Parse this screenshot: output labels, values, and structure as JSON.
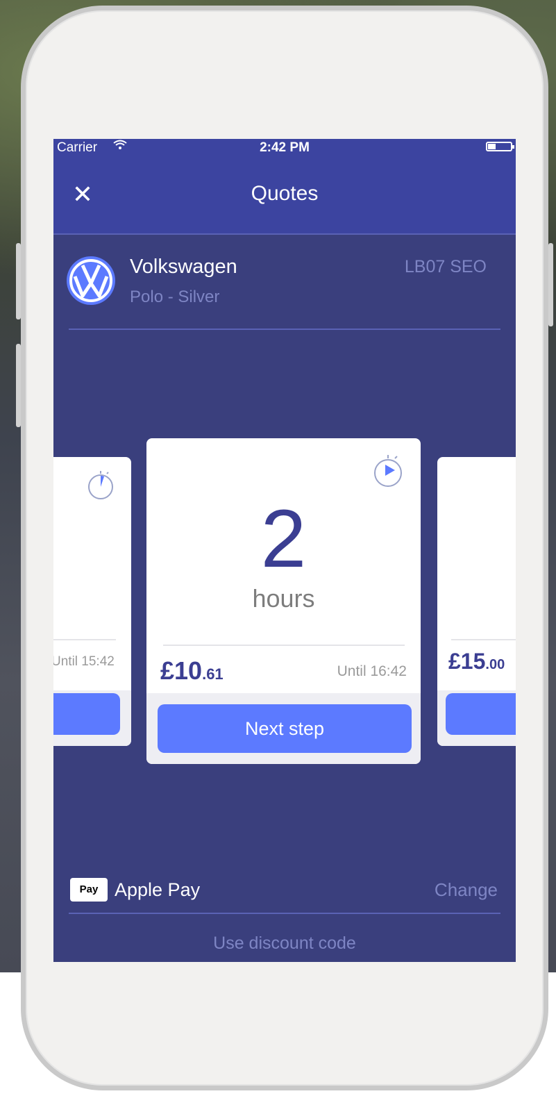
{
  "status_bar": {
    "carrier": "Carrier",
    "wifi_icon": "wifi-icon",
    "time": "2:42 PM",
    "battery_level": 0.35
  },
  "nav": {
    "close_icon": "close-icon",
    "close_glyph": "✕",
    "title": "Quotes"
  },
  "vehicle": {
    "logo_icon": "volkswagen-logo",
    "make": "Volkswagen",
    "model": "Polo - Silver",
    "plate": "LB07 SEO"
  },
  "quotes": {
    "left": {
      "until": "Until 15:42"
    },
    "center": {
      "value": "2",
      "unit": "hours",
      "price_main": "£10",
      "price_cents": ".61",
      "until": "Until 16:42",
      "button_label": "Next step"
    },
    "right": {
      "price_main": "£15",
      "price_cents": ".00"
    }
  },
  "payment": {
    "badge_text": "Pay",
    "badge_apple_glyph": "",
    "method": "Apple Pay",
    "change_label": "Change"
  },
  "discount": {
    "label": "Use discount code"
  },
  "colors": {
    "screen_bg": "#3a3f7d",
    "header_bg": "#3c44a0",
    "accent_button": "#5c7aff",
    "price_text": "#3b3e92",
    "muted_text": "#7e85c4"
  }
}
